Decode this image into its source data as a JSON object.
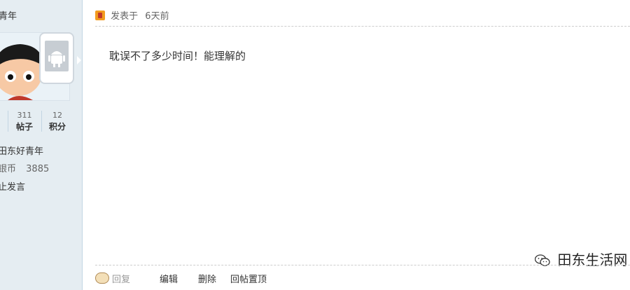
{
  "sidebar": {
    "user_title": "青年",
    "stats": [
      {
        "num": "311",
        "label": "帖子"
      },
      {
        "num": "12",
        "label": "积分"
      }
    ],
    "group": "田东好青年",
    "coins_label": "银币",
    "coins_value": "3885",
    "status": "止发言"
  },
  "post": {
    "posted_label": "发表于",
    "time": "6天前",
    "content": "耽误不了多少时间！能理解的"
  },
  "actions": {
    "reply": "回复",
    "edit": "编辑",
    "delete": "删除",
    "pin": "回帖置顶"
  },
  "watermark": {
    "text": "田东生活网"
  },
  "colors": {
    "sidebar_bg": "#e5edf2",
    "border": "#c2d5e3",
    "icon_orange": "#f29c1f"
  }
}
